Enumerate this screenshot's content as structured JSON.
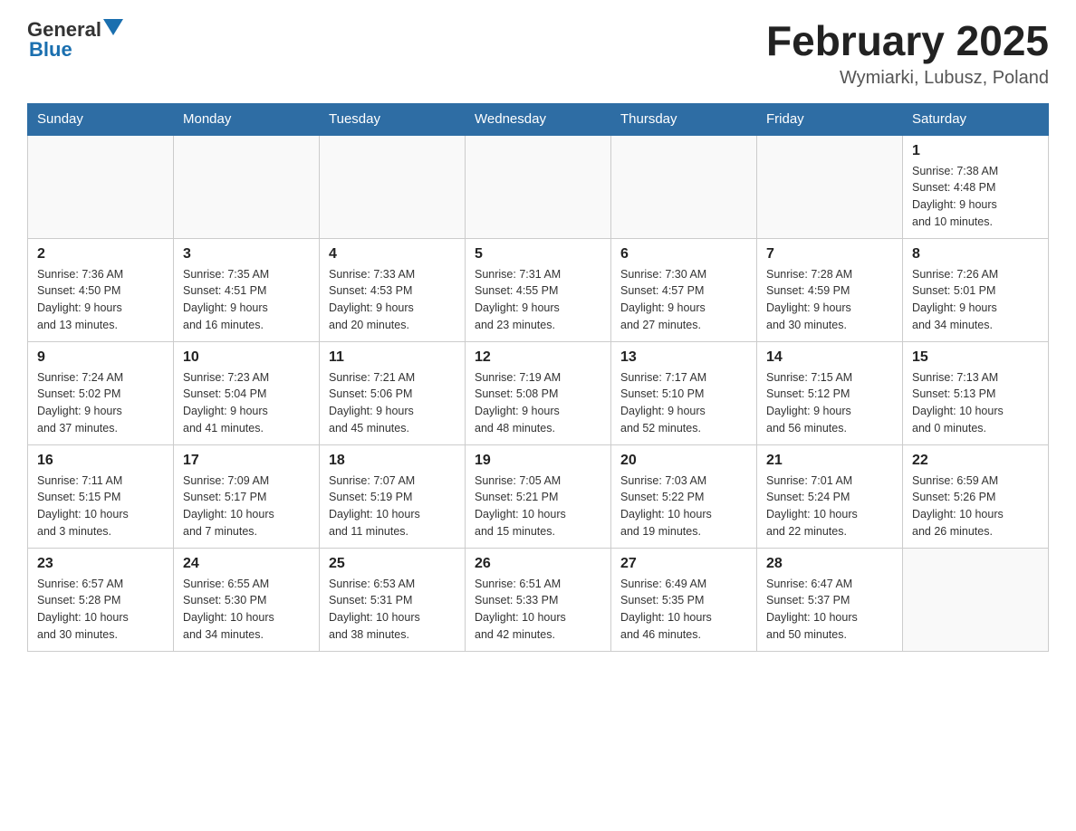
{
  "header": {
    "logo_general": "General",
    "logo_blue": "Blue",
    "month_title": "February 2025",
    "location": "Wymiarki, Lubusz, Poland"
  },
  "days_of_week": [
    "Sunday",
    "Monday",
    "Tuesday",
    "Wednesday",
    "Thursday",
    "Friday",
    "Saturday"
  ],
  "weeks": [
    [
      {
        "day": "",
        "info": ""
      },
      {
        "day": "",
        "info": ""
      },
      {
        "day": "",
        "info": ""
      },
      {
        "day": "",
        "info": ""
      },
      {
        "day": "",
        "info": ""
      },
      {
        "day": "",
        "info": ""
      },
      {
        "day": "1",
        "info": "Sunrise: 7:38 AM\nSunset: 4:48 PM\nDaylight: 9 hours\nand 10 minutes."
      }
    ],
    [
      {
        "day": "2",
        "info": "Sunrise: 7:36 AM\nSunset: 4:50 PM\nDaylight: 9 hours\nand 13 minutes."
      },
      {
        "day": "3",
        "info": "Sunrise: 7:35 AM\nSunset: 4:51 PM\nDaylight: 9 hours\nand 16 minutes."
      },
      {
        "day": "4",
        "info": "Sunrise: 7:33 AM\nSunset: 4:53 PM\nDaylight: 9 hours\nand 20 minutes."
      },
      {
        "day": "5",
        "info": "Sunrise: 7:31 AM\nSunset: 4:55 PM\nDaylight: 9 hours\nand 23 minutes."
      },
      {
        "day": "6",
        "info": "Sunrise: 7:30 AM\nSunset: 4:57 PM\nDaylight: 9 hours\nand 27 minutes."
      },
      {
        "day": "7",
        "info": "Sunrise: 7:28 AM\nSunset: 4:59 PM\nDaylight: 9 hours\nand 30 minutes."
      },
      {
        "day": "8",
        "info": "Sunrise: 7:26 AM\nSunset: 5:01 PM\nDaylight: 9 hours\nand 34 minutes."
      }
    ],
    [
      {
        "day": "9",
        "info": "Sunrise: 7:24 AM\nSunset: 5:02 PM\nDaylight: 9 hours\nand 37 minutes."
      },
      {
        "day": "10",
        "info": "Sunrise: 7:23 AM\nSunset: 5:04 PM\nDaylight: 9 hours\nand 41 minutes."
      },
      {
        "day": "11",
        "info": "Sunrise: 7:21 AM\nSunset: 5:06 PM\nDaylight: 9 hours\nand 45 minutes."
      },
      {
        "day": "12",
        "info": "Sunrise: 7:19 AM\nSunset: 5:08 PM\nDaylight: 9 hours\nand 48 minutes."
      },
      {
        "day": "13",
        "info": "Sunrise: 7:17 AM\nSunset: 5:10 PM\nDaylight: 9 hours\nand 52 minutes."
      },
      {
        "day": "14",
        "info": "Sunrise: 7:15 AM\nSunset: 5:12 PM\nDaylight: 9 hours\nand 56 minutes."
      },
      {
        "day": "15",
        "info": "Sunrise: 7:13 AM\nSunset: 5:13 PM\nDaylight: 10 hours\nand 0 minutes."
      }
    ],
    [
      {
        "day": "16",
        "info": "Sunrise: 7:11 AM\nSunset: 5:15 PM\nDaylight: 10 hours\nand 3 minutes."
      },
      {
        "day": "17",
        "info": "Sunrise: 7:09 AM\nSunset: 5:17 PM\nDaylight: 10 hours\nand 7 minutes."
      },
      {
        "day": "18",
        "info": "Sunrise: 7:07 AM\nSunset: 5:19 PM\nDaylight: 10 hours\nand 11 minutes."
      },
      {
        "day": "19",
        "info": "Sunrise: 7:05 AM\nSunset: 5:21 PM\nDaylight: 10 hours\nand 15 minutes."
      },
      {
        "day": "20",
        "info": "Sunrise: 7:03 AM\nSunset: 5:22 PM\nDaylight: 10 hours\nand 19 minutes."
      },
      {
        "day": "21",
        "info": "Sunrise: 7:01 AM\nSunset: 5:24 PM\nDaylight: 10 hours\nand 22 minutes."
      },
      {
        "day": "22",
        "info": "Sunrise: 6:59 AM\nSunset: 5:26 PM\nDaylight: 10 hours\nand 26 minutes."
      }
    ],
    [
      {
        "day": "23",
        "info": "Sunrise: 6:57 AM\nSunset: 5:28 PM\nDaylight: 10 hours\nand 30 minutes."
      },
      {
        "day": "24",
        "info": "Sunrise: 6:55 AM\nSunset: 5:30 PM\nDaylight: 10 hours\nand 34 minutes."
      },
      {
        "day": "25",
        "info": "Sunrise: 6:53 AM\nSunset: 5:31 PM\nDaylight: 10 hours\nand 38 minutes."
      },
      {
        "day": "26",
        "info": "Sunrise: 6:51 AM\nSunset: 5:33 PM\nDaylight: 10 hours\nand 42 minutes."
      },
      {
        "day": "27",
        "info": "Sunrise: 6:49 AM\nSunset: 5:35 PM\nDaylight: 10 hours\nand 46 minutes."
      },
      {
        "day": "28",
        "info": "Sunrise: 6:47 AM\nSunset: 5:37 PM\nDaylight: 10 hours\nand 50 minutes."
      },
      {
        "day": "",
        "info": ""
      }
    ]
  ]
}
